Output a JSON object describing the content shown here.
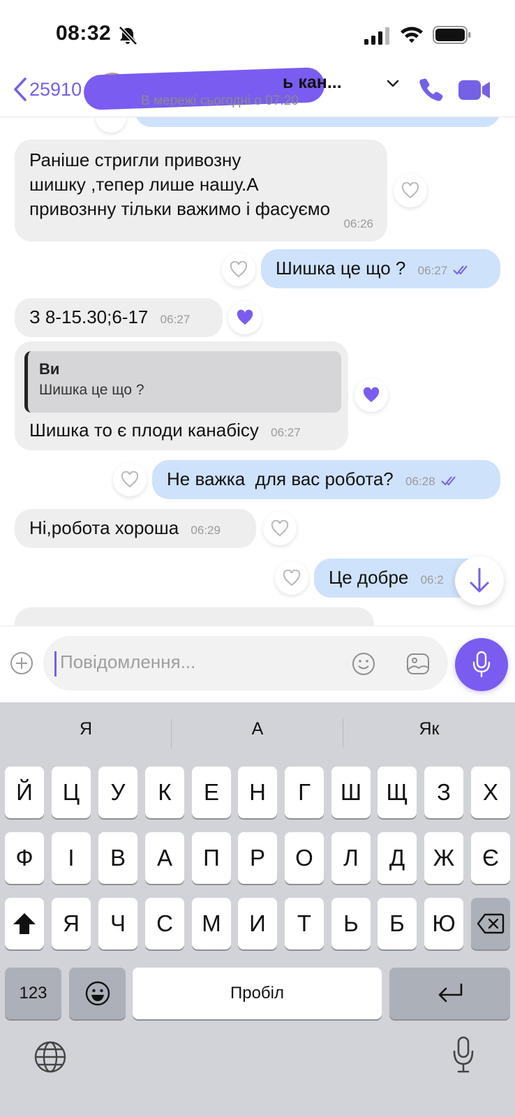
{
  "status_bar": {
    "time": "08:32",
    "icons": [
      "bell-slash-icon",
      "signal-icon",
      "wifi-icon",
      "battery-icon"
    ]
  },
  "header": {
    "back_label": "25910",
    "title": "ь кан...",
    "subtitle": "В мережі сьогодні о 07:20",
    "icons": [
      "chevron-left-icon",
      "chevron-down-icon",
      "phone-icon",
      "video-camera-icon"
    ],
    "accent_color": "#7361e6"
  },
  "messages": [
    {
      "direction": "in",
      "lines": [
        "Раніше стригли привозну",
        "шишку ,тепер лише нашу.А",
        "привознну тільки важимо і фасуємо"
      ],
      "time": "06:26",
      "liked": false
    },
    {
      "direction": "out",
      "text": "Шишка це що ?",
      "time": "06:27",
      "read": true,
      "liked": false
    },
    {
      "direction": "in",
      "text": "З 8-15.30;6-17",
      "time": "06:27",
      "liked": true
    },
    {
      "direction": "in",
      "quote": {
        "author": "Ви",
        "text": "Шишка це що ?"
      },
      "text": "Шишка то є плоди канабісу",
      "time": "06:27",
      "liked": true
    },
    {
      "direction": "out",
      "text": "Не важка  для вас робота?",
      "time": "06:28",
      "read": true,
      "liked": false
    },
    {
      "direction": "in",
      "text": "Ні,робота хороша",
      "time": "06:29",
      "liked": false
    },
    {
      "direction": "out",
      "text": "Це добре",
      "time": "06:2",
      "liked": false
    }
  ],
  "composer": {
    "placeholder": "Повідомлення...",
    "icons": [
      "plus-circle-icon",
      "smiley-icon",
      "sticker-icon",
      "microphone-icon"
    ]
  },
  "keyboard": {
    "suggestions": [
      "Я",
      "А",
      "Як"
    ],
    "row1": [
      "Й",
      "Ц",
      "У",
      "К",
      "Е",
      "Н",
      "Г",
      "Ш",
      "Щ",
      "З",
      "Х"
    ],
    "row2": [
      "Ф",
      "І",
      "В",
      "А",
      "П",
      "Р",
      "О",
      "Л",
      "Д",
      "Ж",
      "Є"
    ],
    "row3": [
      "Я",
      "Ч",
      "С",
      "М",
      "И",
      "Т",
      "Ь",
      "Б",
      "Ю"
    ],
    "numbers_label": "123",
    "space_label": "Пробіл",
    "icons": [
      "shift-icon",
      "backspace-icon",
      "emoji-key-icon",
      "return-icon",
      "globe-icon",
      "dictation-icon"
    ]
  }
}
